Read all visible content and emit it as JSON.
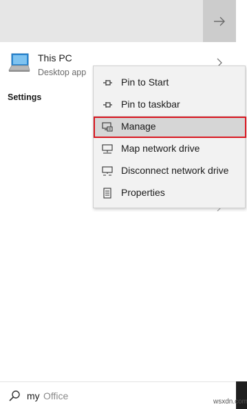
{
  "search_results": {
    "best_match": {
      "title": "This PC",
      "subtitle": "Desktop app",
      "icon": "computer-icon"
    },
    "section_heading": "Settings"
  },
  "context_menu": {
    "items": [
      {
        "label": "Pin to Start",
        "icon": "pin-icon",
        "highlighted": false
      },
      {
        "label": "Pin to taskbar",
        "icon": "pin-icon",
        "highlighted": false
      },
      {
        "label": "Manage",
        "icon": "computer-management-icon",
        "highlighted": true
      },
      {
        "label": "Map network drive",
        "icon": "network-drive-icon",
        "highlighted": false
      },
      {
        "label": "Disconnect network drive",
        "icon": "disconnect-network-drive-icon",
        "highlighted": false
      },
      {
        "label": "Properties",
        "icon": "properties-icon",
        "highlighted": false
      }
    ]
  },
  "search_box": {
    "typed_text": "my",
    "suggestion_text": "Office"
  },
  "watermark": "wsxdn.com",
  "colors": {
    "highlight_border": "#d9151f",
    "menu_background": "#f2f2f2",
    "hover_background": "#d6d6d6"
  }
}
